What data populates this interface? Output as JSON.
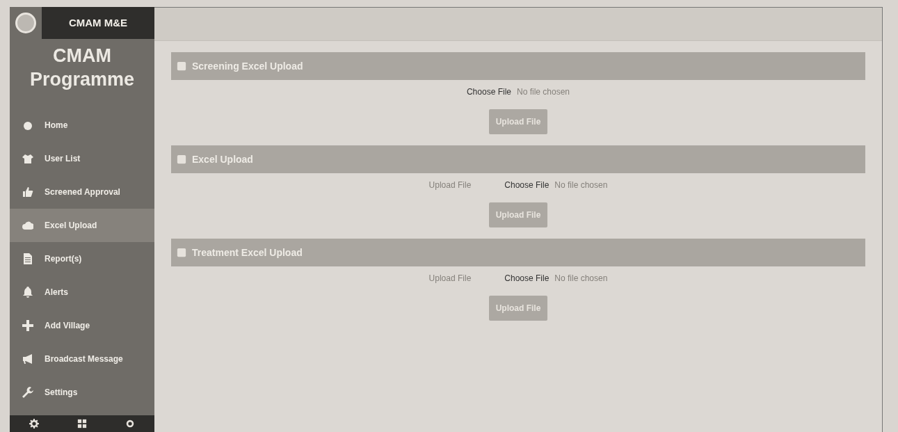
{
  "brand": {
    "title": "CMAM M&E"
  },
  "sidebar": {
    "heading": "CMAM Programme",
    "items": [
      {
        "label": "Home",
        "selected": false
      },
      {
        "label": "User List",
        "selected": false
      },
      {
        "label": "Screened Approval",
        "selected": false
      },
      {
        "label": "Excel Upload",
        "selected": true
      },
      {
        "label": "Report(s)",
        "selected": false
      },
      {
        "label": "Alerts",
        "selected": false
      },
      {
        "label": "Add Village",
        "selected": false
      },
      {
        "label": "Broadcast Message",
        "selected": false
      },
      {
        "label": "Settings",
        "selected": false
      }
    ]
  },
  "sections": [
    {
      "heading": "Screening Excel Upload",
      "file_button": "Choose File",
      "file_status": "No file chosen",
      "submit": "Upload File"
    },
    {
      "heading": "Excel Upload",
      "field_label": "Upload File",
      "file_button": "Choose File",
      "file_status": "No file chosen",
      "submit": "Upload File"
    },
    {
      "heading": "Treatment Excel Upload",
      "field_label": "Upload File",
      "file_button": "Choose File",
      "file_status": "No file chosen",
      "submit": "Upload File"
    }
  ]
}
